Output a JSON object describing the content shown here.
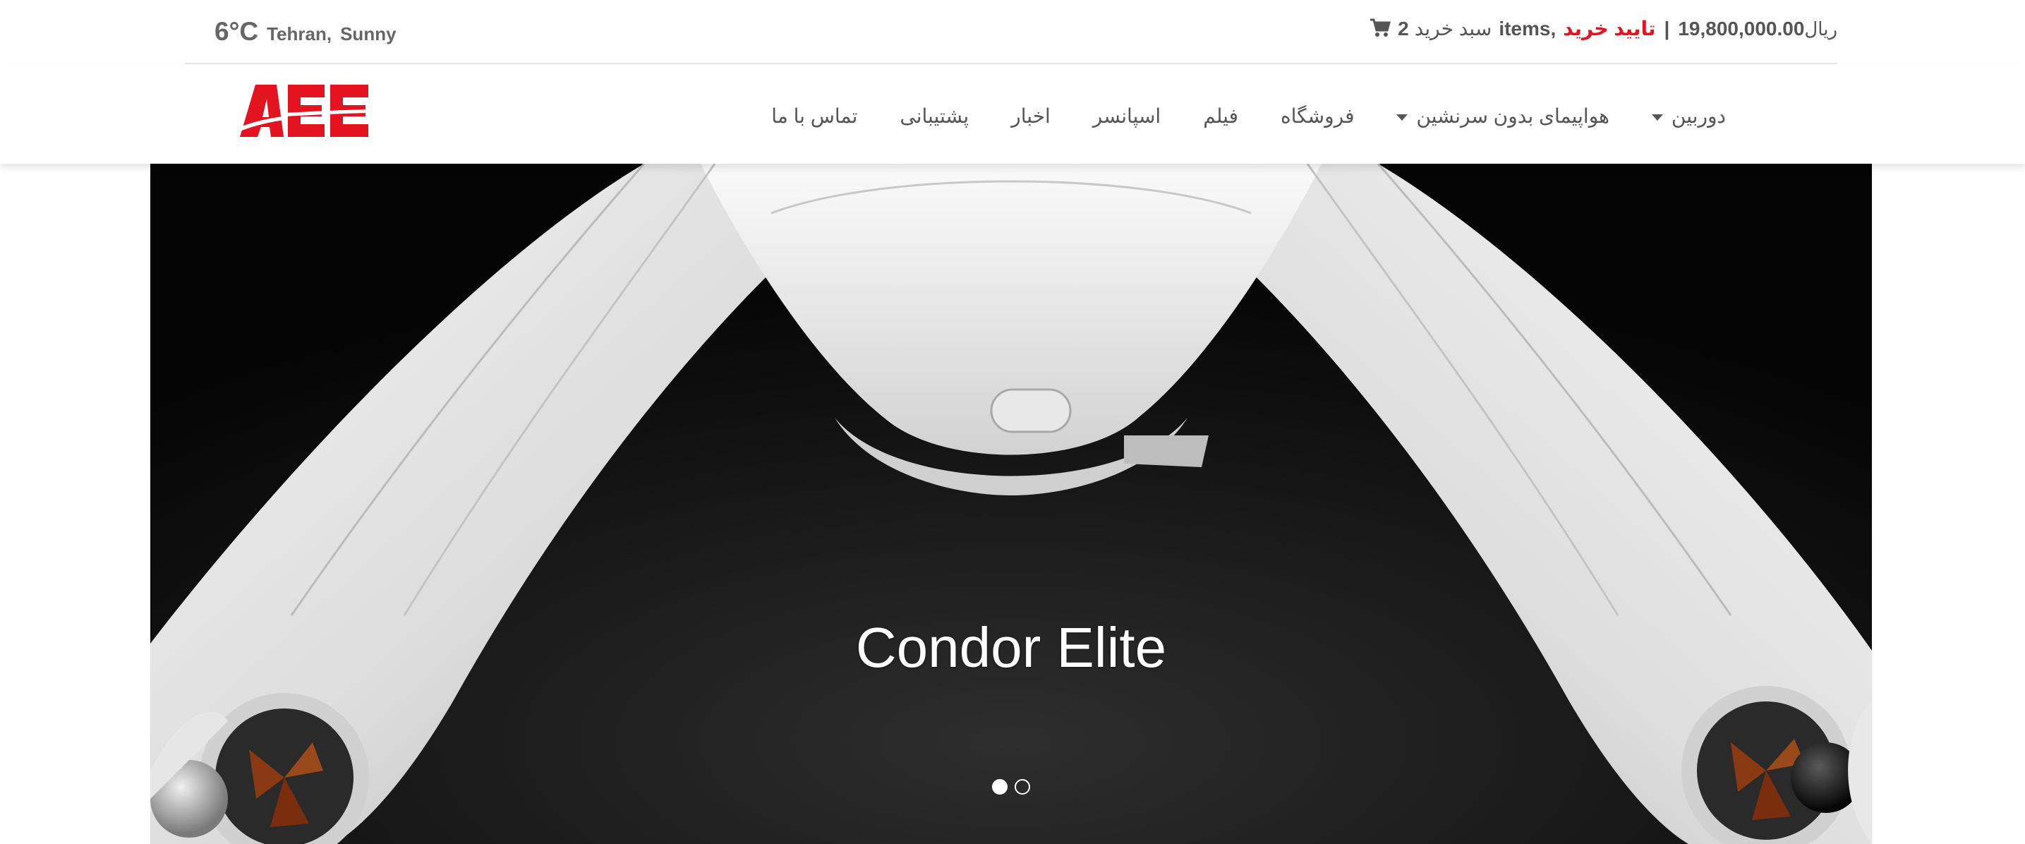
{
  "weather": {
    "temperature": "6°C",
    "city": "Tehran,",
    "condition": "Sunny"
  },
  "cart": {
    "icon": "shopping-cart-icon",
    "count": "2",
    "label": "سبد خرید",
    "items_word": "items",
    "comma": ",",
    "checkout": "تایید خرید",
    "separator": "|",
    "total": "19,800,000.00",
    "currency": "ریال"
  },
  "logo": {
    "text": "AEE",
    "color": "#e3141f"
  },
  "nav": {
    "items": [
      {
        "label": "دوربین",
        "dropdown": true
      },
      {
        "label": "هواپیمای بدون سرنشین",
        "dropdown": true
      },
      {
        "label": "فروشگاه",
        "dropdown": false
      },
      {
        "label": "فیلم",
        "dropdown": false
      },
      {
        "label": "اسپانسر",
        "dropdown": false
      },
      {
        "label": "اخبار",
        "dropdown": false
      },
      {
        "label": "پشتیبانی",
        "dropdown": false
      },
      {
        "label": "تماس با ما",
        "dropdown": false
      }
    ]
  },
  "hero": {
    "caption": "Condor Elite",
    "slides": 2,
    "active_slide": 1
  },
  "colors": {
    "accent": "#e3141f",
    "text": "#555555",
    "hero_bg": "#0d0d0d"
  }
}
